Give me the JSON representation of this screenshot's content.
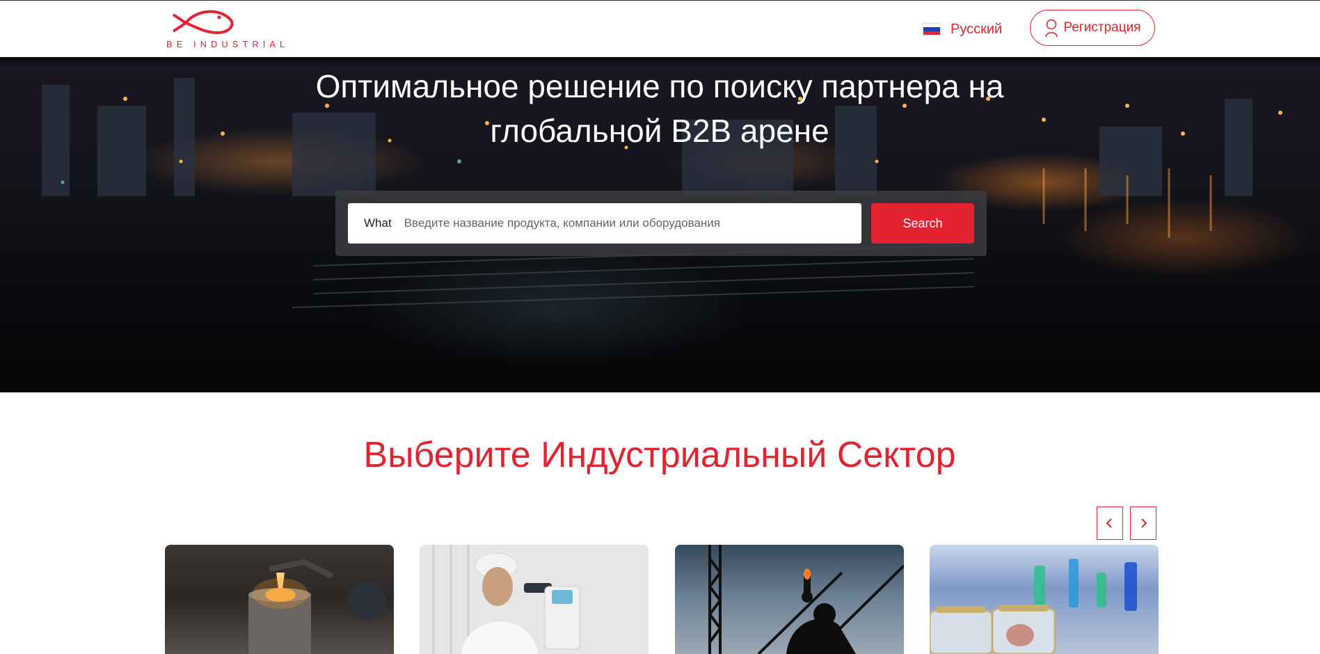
{
  "brand": {
    "name": "BE INDUSTRIAL",
    "accent_color": "#e3232f"
  },
  "header": {
    "language": {
      "label": "Русский",
      "flag": "russia-flag-icon"
    },
    "register_label": "Регистрация",
    "register_icon": "user-icon"
  },
  "hero": {
    "title": "Оптимальное решение по поиску партнера на глобальной B2B арене",
    "search": {
      "field_label": "What",
      "placeholder": "Введите название продукта, компании или оборудования",
      "value": "",
      "button_label": "Search"
    }
  },
  "sectors": {
    "title": "Выберите Индустриальный Сектор",
    "prev_icon": "chevron-left-icon",
    "next_icon": "chevron-right-icon",
    "cards": [
      {
        "image": "metal-casting-photo"
      },
      {
        "image": "laboratory-microscope-photo"
      },
      {
        "image": "construction-worker-crane-photo"
      },
      {
        "image": "chemical-lab-glassware-photo"
      }
    ]
  }
}
